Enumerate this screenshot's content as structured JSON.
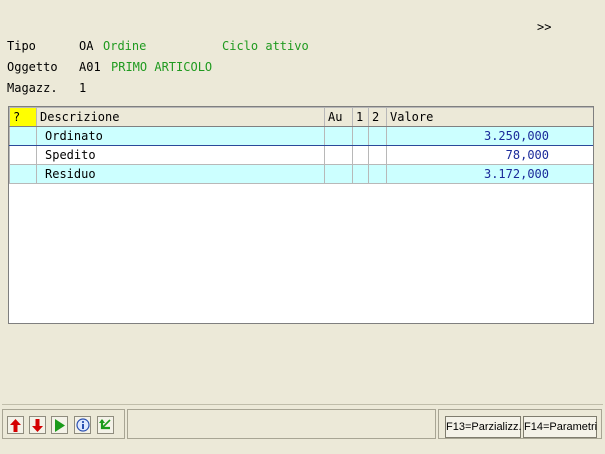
{
  "nav": {
    "more": ">>"
  },
  "header": {
    "tipo_label": "Tipo",
    "tipo_code": "OA",
    "tipo_value": "Ordine",
    "ciclo": "Ciclo attivo",
    "oggetto_label": "Oggetto",
    "oggetto_code": "A01",
    "oggetto_value": "PRIMO ARTICOLO",
    "magazz_label": "Magazz.",
    "magazz_value": "1"
  },
  "grid": {
    "columns": {
      "help": "?",
      "descrizione": "Descrizione",
      "au": "Au",
      "c1": "1",
      "c2": "2",
      "valore": "Valore"
    },
    "rows": [
      {
        "descrizione": "Ordinato",
        "valore": "3.250,000"
      },
      {
        "descrizione": "Spedito",
        "valore": "78,000"
      },
      {
        "descrizione": "Residuo",
        "valore": "3.172,000"
      }
    ]
  },
  "toolbar": {
    "icons": [
      "arrow-up-icon",
      "arrow-down-icon",
      "play-icon",
      "info-icon",
      "refresh-icon"
    ],
    "f13": "F13=Parzializz.",
    "f14": "F14=Parametri"
  },
  "colors": {
    "green_text": "#1f9a1f",
    "value_blue": "#1a2a9a",
    "row_alt": "#ccffff",
    "help_yellow": "#ffff00"
  }
}
